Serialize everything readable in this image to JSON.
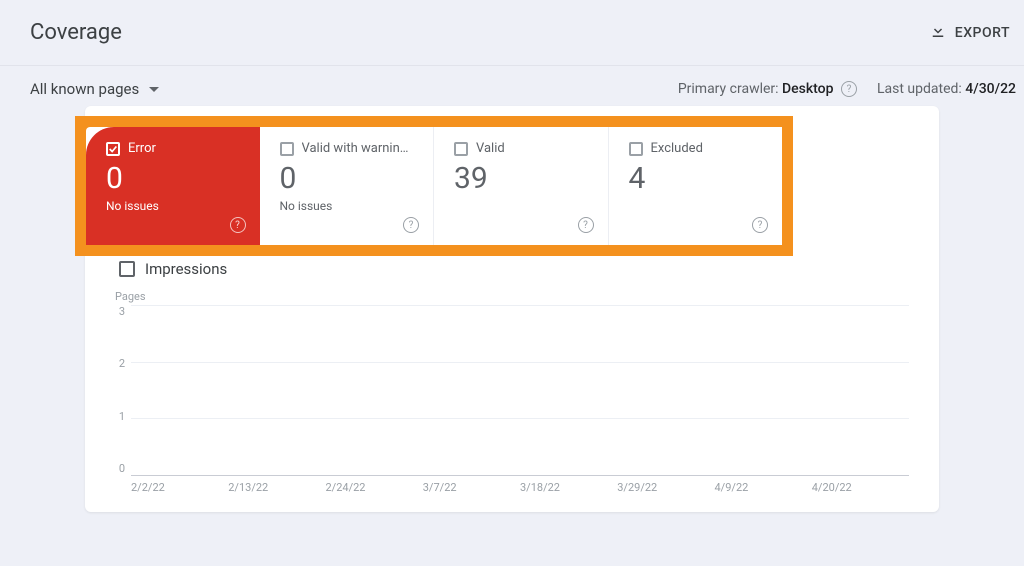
{
  "header": {
    "title": "Coverage",
    "export_label": "EXPORT"
  },
  "filter": {
    "label": "All known pages"
  },
  "subheader": {
    "crawler_label": "Primary crawler: ",
    "crawler_value": "Desktop",
    "updated_label": "Last updated: ",
    "updated_value": "4/30/22"
  },
  "cards": [
    {
      "label": "Error",
      "value": "0",
      "sub": "No issues",
      "active": true,
      "checked": true
    },
    {
      "label": "Valid with warnin…",
      "value": "0",
      "sub": "No issues",
      "active": false,
      "checked": false
    },
    {
      "label": "Valid",
      "value": "39",
      "sub": "",
      "active": false,
      "checked": false
    },
    {
      "label": "Excluded",
      "value": "4",
      "sub": "",
      "active": false,
      "checked": false
    }
  ],
  "impressions": {
    "label": "Impressions"
  },
  "chart_data": {
    "type": "line",
    "ylabel": "Pages",
    "ylim": [
      0,
      3
    ],
    "yticks": [
      "3",
      "2",
      "1",
      "0"
    ],
    "categories": [
      "2/2/22",
      "2/13/22",
      "2/24/22",
      "3/7/22",
      "3/18/22",
      "3/29/22",
      "4/9/22",
      "4/20/22"
    ],
    "series": [
      {
        "name": "Error",
        "values": [
          0,
          0,
          0,
          0,
          0,
          0,
          0,
          0
        ]
      }
    ]
  }
}
